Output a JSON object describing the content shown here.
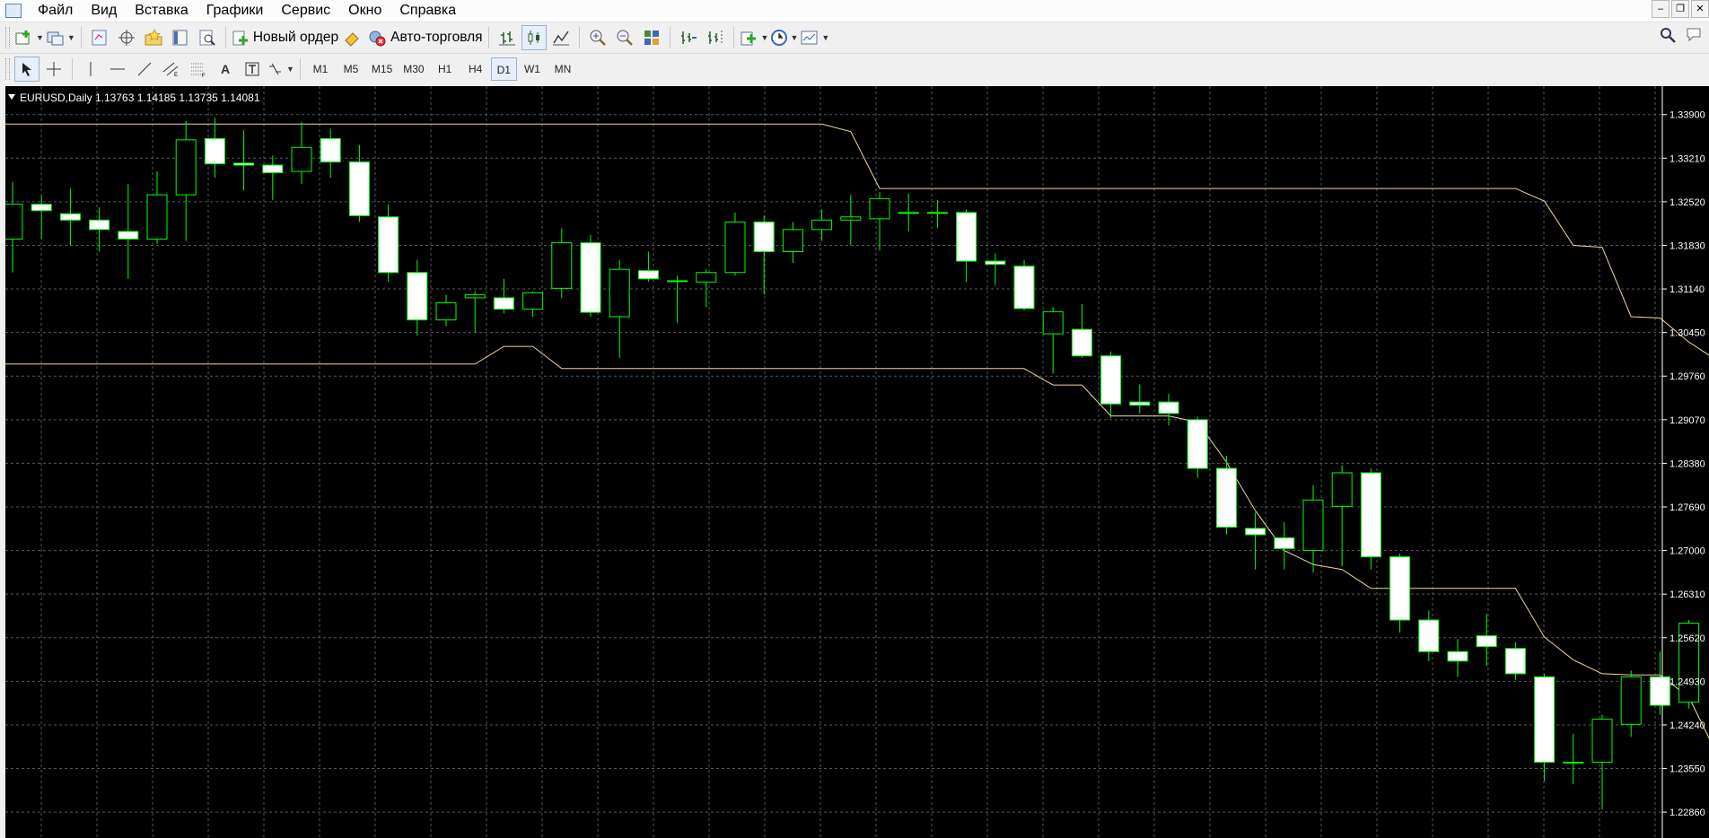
{
  "menu": {
    "items": [
      "Файл",
      "Вид",
      "Вставка",
      "Графики",
      "Сервис",
      "Окно",
      "Справка"
    ]
  },
  "toolbar": {
    "new_order_label": "Новый ордер",
    "autotrading_label": "Авто-торговля"
  },
  "timeframes": {
    "items": [
      "M1",
      "M5",
      "M15",
      "M30",
      "H1",
      "H4",
      "D1",
      "W1",
      "MN"
    ],
    "active": "D1"
  },
  "drawing_tools": {
    "text_label": "A"
  },
  "chart_header": {
    "symbol": "EURUSD,Daily",
    "ohlc": "1.13763 1.14185 1.13735 1.14081"
  },
  "colors": {
    "background": "#000000",
    "grid": "#4d5a5a",
    "bull_body": "#000000",
    "bear_body": "#ffffff",
    "candle_outline": "#00ff00",
    "indicator_line": "#f3d6a0",
    "axis_text": "#ffffff"
  },
  "chart_data": {
    "type": "candlestick",
    "symbol": "EURUSD",
    "timeframe": "Daily",
    "ylim": [
      1.2245,
      1.3435
    ],
    "y_ticks": [
      "1.33900",
      "1.33210",
      "1.32520",
      "1.31830",
      "1.31140",
      "1.30450",
      "1.29760",
      "1.29070",
      "1.28380",
      "1.27690",
      "1.27000",
      "1.26310",
      "1.25620",
      "1.24930",
      "1.24240",
      "1.23550",
      "1.22860"
    ],
    "grid": true,
    "candles": [
      {
        "o": 1.3193,
        "h": 1.3283,
        "l": 1.314,
        "c": 1.3248
      },
      {
        "o": 1.3248,
        "h": 1.3262,
        "l": 1.3193,
        "c": 1.3238
      },
      {
        "o": 1.3233,
        "h": 1.3273,
        "l": 1.3183,
        "c": 1.3223
      },
      {
        "o": 1.3223,
        "h": 1.3243,
        "l": 1.3173,
        "c": 1.3208
      },
      {
        "o": 1.3205,
        "h": 1.328,
        "l": 1.313,
        "c": 1.3193
      },
      {
        "o": 1.3193,
        "h": 1.33,
        "l": 1.3185,
        "c": 1.3263
      },
      {
        "o": 1.3263,
        "h": 1.338,
        "l": 1.319,
        "c": 1.335
      },
      {
        "o": 1.3352,
        "h": 1.3385,
        "l": 1.329,
        "c": 1.3312
      },
      {
        "o": 1.3313,
        "h": 1.3365,
        "l": 1.327,
        "c": 1.331
      },
      {
        "o": 1.331,
        "h": 1.3325,
        "l": 1.3255,
        "c": 1.3298
      },
      {
        "o": 1.33,
        "h": 1.3378,
        "l": 1.328,
        "c": 1.3338
      },
      {
        "o": 1.3352,
        "h": 1.3368,
        "l": 1.329,
        "c": 1.3315
      },
      {
        "o": 1.3315,
        "h": 1.3342,
        "l": 1.322,
        "c": 1.323
      },
      {
        "o": 1.3228,
        "h": 1.3248,
        "l": 1.3125,
        "c": 1.314
      },
      {
        "o": 1.314,
        "h": 1.316,
        "l": 1.304,
        "c": 1.3065
      },
      {
        "o": 1.3065,
        "h": 1.3105,
        "l": 1.3055,
        "c": 1.3092
      },
      {
        "o": 1.31,
        "h": 1.311,
        "l": 1.3045,
        "c": 1.3105
      },
      {
        "o": 1.31,
        "h": 1.313,
        "l": 1.3075,
        "c": 1.3082
      },
      {
        "o": 1.3082,
        "h": 1.311,
        "l": 1.307,
        "c": 1.3108
      },
      {
        "o": 1.3115,
        "h": 1.321,
        "l": 1.31,
        "c": 1.3187
      },
      {
        "o": 1.3187,
        "h": 1.32,
        "l": 1.307,
        "c": 1.3077
      },
      {
        "o": 1.307,
        "h": 1.316,
        "l": 1.3005,
        "c": 1.3145
      },
      {
        "o": 1.3143,
        "h": 1.3173,
        "l": 1.3125,
        "c": 1.313
      },
      {
        "o": 1.3127,
        "h": 1.3135,
        "l": 1.306,
        "c": 1.3127
      },
      {
        "o": 1.3125,
        "h": 1.3145,
        "l": 1.3085,
        "c": 1.314
      },
      {
        "o": 1.314,
        "h": 1.3235,
        "l": 1.3135,
        "c": 1.322
      },
      {
        "o": 1.322,
        "h": 1.323,
        "l": 1.3105,
        "c": 1.3173
      },
      {
        "o": 1.3173,
        "h": 1.322,
        "l": 1.3155,
        "c": 1.3208
      },
      {
        "o": 1.3208,
        "h": 1.324,
        "l": 1.319,
        "c": 1.3223
      },
      {
        "o": 1.3223,
        "h": 1.3263,
        "l": 1.3183,
        "c": 1.3228
      },
      {
        "o": 1.3225,
        "h": 1.3267,
        "l": 1.3175,
        "c": 1.3257
      },
      {
        "o": 1.3235,
        "h": 1.3265,
        "l": 1.3205,
        "c": 1.3235
      },
      {
        "o": 1.3235,
        "h": 1.3255,
        "l": 1.321,
        "c": 1.3235
      },
      {
        "o": 1.3235,
        "h": 1.324,
        "l": 1.3125,
        "c": 1.3158
      },
      {
        "o": 1.3158,
        "h": 1.317,
        "l": 1.312,
        "c": 1.3153
      },
      {
        "o": 1.315,
        "h": 1.316,
        "l": 1.308,
        "c": 1.3083
      },
      {
        "o": 1.3043,
        "h": 1.3085,
        "l": 1.298,
        "c": 1.3078
      },
      {
        "o": 1.305,
        "h": 1.309,
        "l": 1.3005,
        "c": 1.3008
      },
      {
        "o": 1.3008,
        "h": 1.3015,
        "l": 1.291,
        "c": 1.2932
      },
      {
        "o": 1.2935,
        "h": 1.2963,
        "l": 1.2917,
        "c": 1.293
      },
      {
        "o": 1.2935,
        "h": 1.2948,
        "l": 1.2898,
        "c": 1.2917
      },
      {
        "o": 1.2907,
        "h": 1.2912,
        "l": 1.2815,
        "c": 1.283
      },
      {
        "o": 1.283,
        "h": 1.285,
        "l": 1.2725,
        "c": 1.2737
      },
      {
        "o": 1.2735,
        "h": 1.276,
        "l": 1.267,
        "c": 1.2725
      },
      {
        "o": 1.272,
        "h": 1.2745,
        "l": 1.267,
        "c": 1.2703
      },
      {
        "o": 1.27,
        "h": 1.2803,
        "l": 1.2665,
        "c": 1.278
      },
      {
        "o": 1.277,
        "h": 1.2835,
        "l": 1.2675,
        "c": 1.2823
      },
      {
        "o": 1.2823,
        "h": 1.283,
        "l": 1.267,
        "c": 1.269
      },
      {
        "o": 1.269,
        "h": 1.2695,
        "l": 1.257,
        "c": 1.259
      },
      {
        "o": 1.259,
        "h": 1.2605,
        "l": 1.2525,
        "c": 1.254
      },
      {
        "o": 1.254,
        "h": 1.256,
        "l": 1.25,
        "c": 1.2525
      },
      {
        "o": 1.2565,
        "h": 1.26,
        "l": 1.2517,
        "c": 1.2548
      },
      {
        "o": 1.2545,
        "h": 1.2555,
        "l": 1.2495,
        "c": 1.2505
      },
      {
        "o": 1.25,
        "h": 1.2505,
        "l": 1.2335,
        "c": 1.2365
      },
      {
        "o": 1.2365,
        "h": 1.241,
        "l": 1.233,
        "c": 1.2365
      },
      {
        "o": 1.2365,
        "h": 1.244,
        "l": 1.229,
        "c": 1.2433
      },
      {
        "o": 1.2425,
        "h": 1.251,
        "l": 1.2405,
        "c": 1.25
      },
      {
        "o": 1.25,
        "h": 1.254,
        "l": 1.244,
        "c": 1.2455
      },
      {
        "o": 1.246,
        "h": 1.259,
        "l": 1.245,
        "c": 1.2585
      }
    ],
    "indicator_line": {
      "first_index": -7,
      "values": [
        1.2995,
        1.2995,
        1.2995,
        1.2995,
        1.2995,
        1.2995,
        1.2995,
        1.2995,
        1.2995,
        1.2995,
        1.2995,
        1.2995,
        1.2995,
        1.2995,
        1.2995,
        1.2995,
        1.2995,
        1.2995,
        1.2995,
        1.2995,
        1.2995,
        1.2995,
        1.2995,
        1.2995,
        1.3023,
        1.3023,
        1.2988,
        1.2988,
        1.2988,
        1.2988,
        1.2988,
        1.2988,
        1.2988,
        1.2988,
        1.2988,
        1.2988,
        1.2988,
        1.2988,
        1.2988,
        1.2988,
        1.2988,
        1.2988,
        1.2988,
        1.2962,
        1.2962,
        1.2913,
        1.2913,
        1.2913,
        1.2903,
        1.284,
        1.2763,
        1.27,
        1.2678,
        1.267,
        1.264,
        1.264,
        1.264,
        1.264,
        1.264,
        1.264,
        1.2563,
        1.2527,
        1.2505,
        1.2503,
        1.2503,
        1.2468,
        1.2375,
        1.2345,
        1.229,
        1.229,
        1.229,
        1.229,
        1.229
      ],
      "upper_values": [
        1.3375,
        1.3375,
        1.3375,
        1.3375,
        1.3375,
        1.3375,
        1.3375,
        1.3375,
        1.3375,
        1.3375,
        1.3375,
        1.3375,
        1.3375,
        1.3375,
        1.3375,
        1.3375,
        1.3375,
        1.3375,
        1.3375,
        1.3375,
        1.3375,
        1.3375,
        1.3375,
        1.3375,
        1.3375,
        1.3375,
        1.3375,
        1.3375,
        1.3375,
        1.3375,
        1.3375,
        1.3375,
        1.3375,
        1.3375,
        1.3375,
        1.3375,
        1.3363,
        1.3273,
        1.3273,
        1.3273,
        1.3273,
        1.3273,
        1.3273,
        1.3273,
        1.3273,
        1.3273,
        1.3273,
        1.3273,
        1.3273,
        1.3273,
        1.3273,
        1.3273,
        1.3273,
        1.3273,
        1.3273,
        1.3273,
        1.3273,
        1.3273,
        1.3273,
        1.3273,
        1.3253,
        1.3183,
        1.318,
        1.307,
        1.3068,
        1.303,
        1.3,
        1.2978
      ],
      "upper_first_index": -7
    }
  }
}
